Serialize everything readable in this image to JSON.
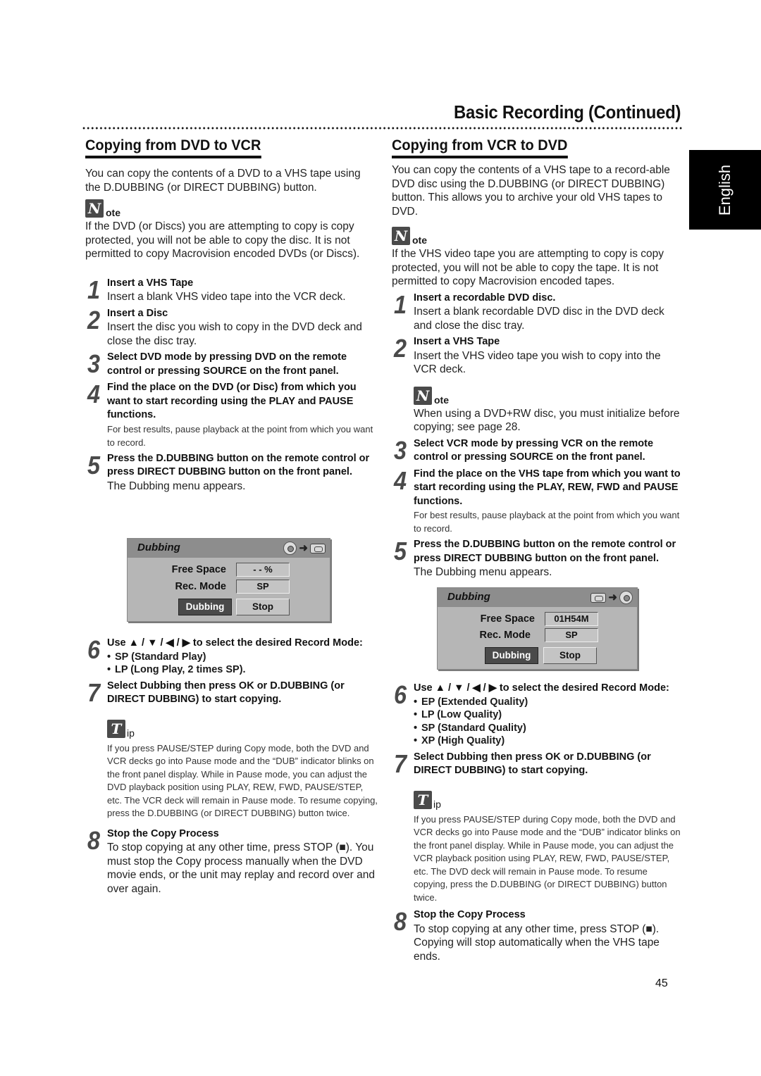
{
  "header": {
    "page_title": "Basic Recording (Continued)",
    "language_tab": "English"
  },
  "left": {
    "title": "Copying from DVD to VCR",
    "intro": "You can copy the contents of a DVD to a VHS tape using the D.DUBBING (or DIRECT DUBBING) button.",
    "note": {
      "icon_letter": "N",
      "label": "ote",
      "text": "If the DVD (or Discs) you are attempting to copy is copy protected, you will not be able to copy the disc. It is not permitted to copy Macrovision encoded DVDs (or Discs)."
    },
    "steps": [
      {
        "num": "1",
        "title": "Insert a VHS Tape",
        "text": "Insert a blank VHS video tape into the VCR deck."
      },
      {
        "num": "2",
        "title": "Insert a Disc",
        "text": "Insert the disc you wish to copy in the DVD deck and close the disc tray."
      },
      {
        "num": "3",
        "title": "Select DVD mode by pressing DVD on the remote control or pressing SOURCE on the front panel."
      },
      {
        "num": "4",
        "title": "Find the place on the DVD (or Disc) from which you want to start recording using the PLAY and PAUSE functions.",
        "small": "For best results, pause playback at the point from which you want to record."
      },
      {
        "num": "5",
        "title": "Press the D.DUBBING button on the remote control or press DIRECT DUBBING button on the front panel.",
        "text": "The Dubbing menu appears."
      },
      {
        "num": "6",
        "title": "Use ▲ / ▼ / ◀ / ▶ to select the desired Record Mode:",
        "bullets": [
          "SP (Standard Play)",
          "LP (Long Play, 2 times SP)."
        ]
      },
      {
        "num": "7",
        "title": "Select Dubbing then press OK or D.DUBBING (or DIRECT DUBBING) to start copying."
      },
      {
        "num": "8",
        "title": "Stop the Copy Process",
        "text": "To stop copying at any other time, press STOP (■). You must stop the Copy process manually when the DVD movie ends, or the unit may replay and record over and over again."
      }
    ],
    "tip": {
      "icon_letter": "T",
      "label": "ip",
      "text": "If you press PAUSE/STEP during Copy mode, both the DVD and VCR decks go into Pause mode and the “DUB” indicator blinks on the front panel display. While in Pause mode, you can adjust the DVD playback position using PLAY, REW, FWD, PAUSE/STEP, etc. The VCR deck will remain in Pause mode. To resume copying, press the D.DUBBING (or DIRECT DUBBING) button twice."
    },
    "menu": {
      "title": "Dubbing",
      "direction": "disc-to-tape",
      "free_space_label": "Free Space",
      "free_space_value": "- - %",
      "rec_mode_label": "Rec. Mode",
      "rec_mode_value": "SP",
      "dubbing_button": "Dubbing",
      "stop_button": "Stop"
    }
  },
  "right": {
    "title": "Copying from VCR to DVD",
    "intro": "You can copy the contents of a VHS tape to a record-able DVD disc using the D.DUBBING (or DIRECT DUBBING) button. This allows you to archive your old VHS tapes to DVD.",
    "note": {
      "icon_letter": "N",
      "label": "ote",
      "text": "If the VHS video tape you are attempting to copy is copy protected, you will not be able to copy the tape. It is not permitted to copy Macrovision encoded tapes."
    },
    "steps": [
      {
        "num": "1",
        "title": "Insert a recordable DVD disc.",
        "text": "Insert a blank recordable DVD disc in the DVD deck and close the disc tray."
      },
      {
        "num": "2",
        "title": "Insert a VHS Tape",
        "text": "Insert the VHS video tape you wish to copy into the VCR deck."
      },
      {
        "num": "3",
        "title": "Select VCR mode by pressing VCR on the remote control or pressing SOURCE on the front panel."
      },
      {
        "num": "4",
        "title": "Find the place on the VHS tape from which you want to start recording using the PLAY, REW, FWD and PAUSE functions.",
        "small": "For best results, pause playback at the point from which you want to record."
      },
      {
        "num": "5",
        "title": "Press the D.DUBBING button on the remote control or press DIRECT DUBBING button on the front panel.",
        "text": "The Dubbing menu appears."
      },
      {
        "num": "6",
        "title": "Use ▲ / ▼ / ◀ / ▶ to select the desired Record Mode:",
        "bullets": [
          "EP (Extended Quality)",
          "LP (Low Quality)",
          "SP (Standard Quality)",
          "XP (High Quality)"
        ]
      },
      {
        "num": "7",
        "title": "Select Dubbing then press OK or D.DUBBING (or DIRECT DUBBING) to start copying."
      },
      {
        "num": "8",
        "title": "Stop the Copy Process",
        "text": "To stop copying at any other time, press STOP (■). Copying will stop automatically when the VHS tape ends."
      }
    ],
    "step_note": {
      "icon_letter": "N",
      "label": "ote",
      "text": "When using a DVD+RW disc, you must initialize before copying; see page 28."
    },
    "tip": {
      "icon_letter": "T",
      "label": "ip",
      "text": "If you press PAUSE/STEP during Copy mode, both the DVD and VCR decks go into Pause mode and the “DUB” indicator blinks on the front panel display. While in Pause mode, you can adjust the VCR playback position using PLAY, REW, FWD, PAUSE/STEP, etc. The DVD deck will remain in Pause mode. To resume copying, press the D.DUBBING (or DIRECT DUBBING) button twice."
    },
    "menu": {
      "title": "Dubbing",
      "direction": "tape-to-disc",
      "free_space_label": "Free Space",
      "free_space_value": "01H54M",
      "rec_mode_label": "Rec. Mode",
      "rec_mode_value": "SP",
      "dubbing_button": "Dubbing",
      "stop_button": "Stop"
    }
  },
  "footer": {
    "page_number": "45"
  }
}
